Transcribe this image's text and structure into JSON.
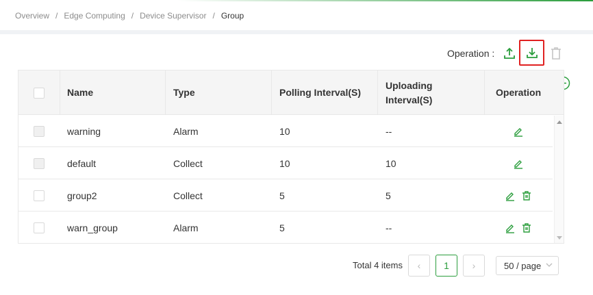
{
  "breadcrumb": {
    "items": [
      "Overview",
      "Edge Computing",
      "Device Supervisor"
    ],
    "current": "Group",
    "separator": "/"
  },
  "toolbar": {
    "operation_label": "Operation :",
    "icons": [
      "upload-icon",
      "download-icon",
      "trash-icon"
    ]
  },
  "table": {
    "columns": [
      "Name",
      "Type",
      "Polling Interval(S)",
      "Uploading Interval(S)",
      "Operation"
    ],
    "uploading_header_line1": "Uploading",
    "uploading_header_line2": "Interval(S)",
    "rows": [
      {
        "name": "warning",
        "type": "Alarm",
        "polling": "10",
        "uploading": "--",
        "deletable": false
      },
      {
        "name": "default",
        "type": "Collect",
        "polling": "10",
        "uploading": "10",
        "deletable": false
      },
      {
        "name": "group2",
        "type": "Collect",
        "polling": "5",
        "uploading": "5",
        "deletable": true
      },
      {
        "name": "warn_group",
        "type": "Alarm",
        "polling": "5",
        "uploading": "--",
        "deletable": true
      }
    ]
  },
  "pagination": {
    "total_text": "Total 4 items",
    "prev": "‹",
    "current_page": "1",
    "next": "›",
    "page_size": "50 / page"
  },
  "colors": {
    "accent": "#2a9d3c",
    "highlight_box": "#e02020"
  }
}
